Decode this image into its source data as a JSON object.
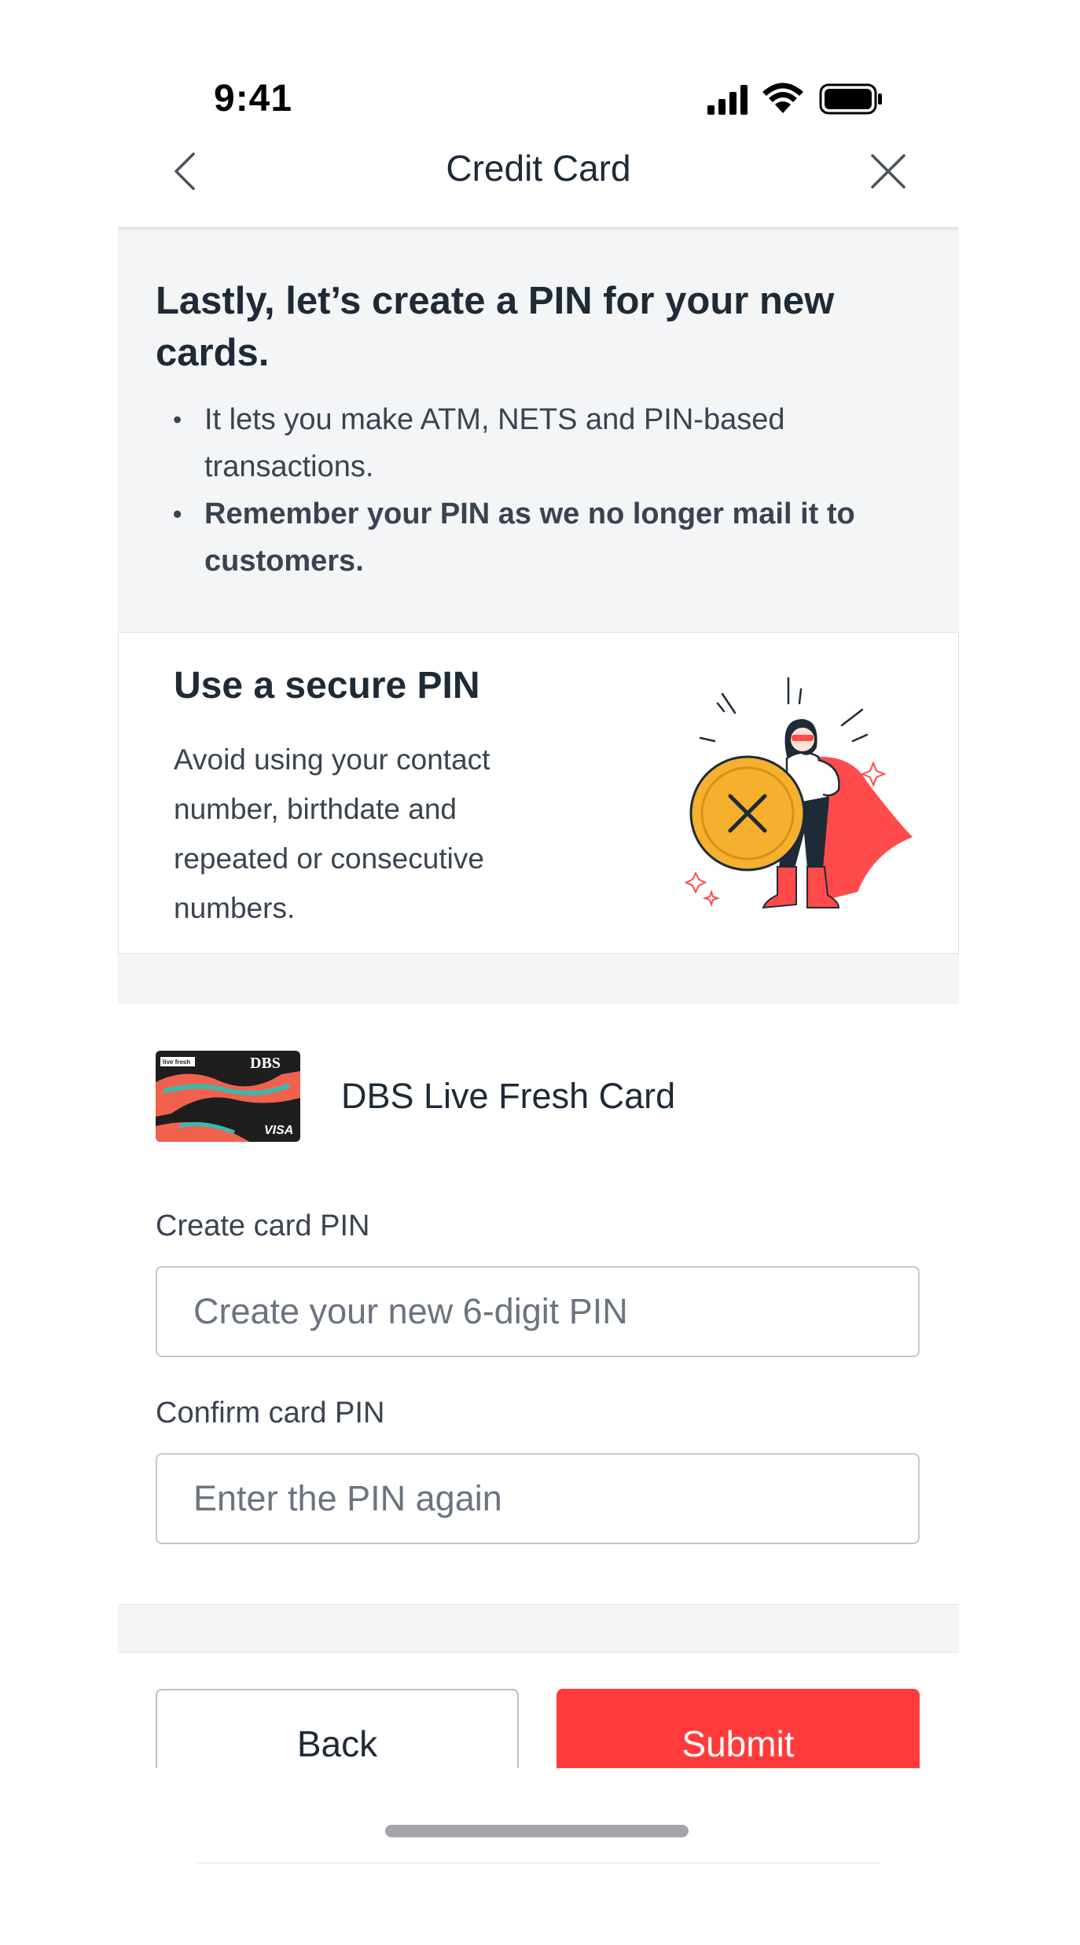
{
  "status_bar": {
    "time": "9:41",
    "icons": [
      "cellular-signal-icon",
      "wifi-icon",
      "battery-icon"
    ]
  },
  "nav": {
    "title": "Credit Card",
    "back_icon": "chevron-left-icon",
    "close_icon": "close-icon"
  },
  "intro": {
    "title": "Lastly, let’s create a PIN for your new cards.",
    "bullets": [
      "It lets you make ATM, NETS and PIN-based transactions.",
      "Remember your PIN as we no longer mail it to customers."
    ]
  },
  "secure_pin": {
    "title": "Use a secure PIN",
    "body": "Avoid using your contact number, birthdate and repeated or consecutive numbers."
  },
  "card": {
    "name": "DBS Live Fresh Card",
    "brand_text": "DBS",
    "network_text": "VISA",
    "product_text": "live fresh"
  },
  "form": {
    "create_label": "Create card PIN",
    "create_placeholder": "Create your new 6-digit PIN",
    "create_value": "",
    "confirm_label": "Confirm card PIN",
    "confirm_placeholder": "Enter the PIN again",
    "confirm_value": ""
  },
  "footer": {
    "back_label": "Back",
    "submit_label": "Submit"
  },
  "colors": {
    "accent": "#ff3b3b",
    "page_bg": "#f4f5f7",
    "text_primary": "#1f2a37",
    "shield": "#f5b02e"
  }
}
